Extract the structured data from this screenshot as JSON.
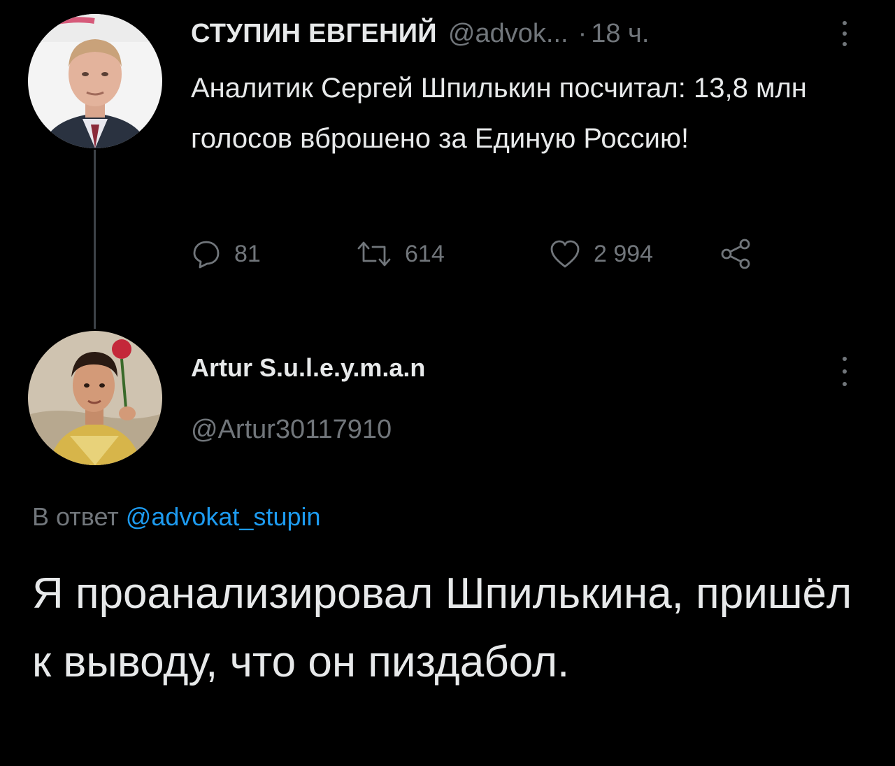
{
  "tweet1": {
    "author_name": "СТУПИН ЕВГЕНИЙ",
    "author_handle": "@advok...",
    "separator": "·",
    "time": "18 ч.",
    "text": "Аналитик Сергей Шпилькин посчитал: 13,8 млн голосов вброшено за Единую Россию!",
    "avatar_icon": "person-photo-avatar",
    "actions": {
      "reply_icon": "reply-icon",
      "reply_count": "81",
      "retweet_icon": "retweet-icon",
      "retweet_count": "614",
      "like_icon": "heart-icon",
      "like_count": "2 994",
      "share_icon": "share-icon"
    }
  },
  "tweet2": {
    "author_name": "Artur S.u.l.e.y.m.a.n",
    "author_handle": "@Artur30117910",
    "avatar_icon": "person-photo-avatar",
    "reply_prefix": "В ответ",
    "reply_mention": "@advokat_stupin",
    "text": "Я проанализировал Шпилькина, пришёл к выводу, что он пиздабол."
  },
  "colors": {
    "background": "#000000",
    "primary_text": "#e7e9ea",
    "secondary_text": "#71767b",
    "link": "#1d9bf0",
    "thread_line": "#3d4248"
  }
}
